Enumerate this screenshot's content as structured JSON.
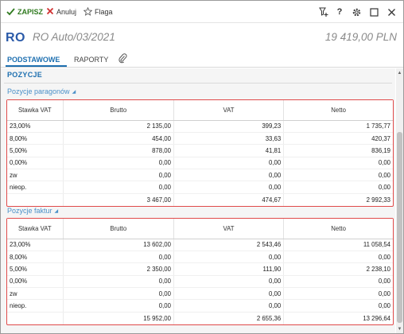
{
  "toolbar": {
    "save_label": "ZAPISZ",
    "cancel_label": "Anuluj",
    "flag_label": "Flaga",
    "right_icons": [
      "add-filter-icon",
      "help-icon",
      "gear-icon",
      "maximize-icon",
      "close-icon"
    ],
    "help_glyph": "?"
  },
  "header": {
    "badge": "RO",
    "title": "RO Auto/03/2021",
    "amount": "19 419,00 PLN"
  },
  "tabs": [
    {
      "label": "PODSTAWOWE",
      "active": true
    },
    {
      "label": "RAPORTY",
      "active": false
    }
  ],
  "section": {
    "title": "POZYCJE"
  },
  "receipts": {
    "title": "Pozycje paragonów",
    "headers": [
      "Stawka VAT",
      "Brutto",
      "VAT",
      "Netto"
    ],
    "rows": [
      {
        "rate": "23,00%",
        "gross": "2 135,00",
        "vat": "399,23",
        "net": "1 735,77"
      },
      {
        "rate": "8,00%",
        "gross": "454,00",
        "vat": "33,63",
        "net": "420,37"
      },
      {
        "rate": "5,00%",
        "gross": "878,00",
        "vat": "41,81",
        "net": "836,19"
      },
      {
        "rate": "0,00%",
        "gross": "0,00",
        "vat": "0,00",
        "net": "0,00"
      },
      {
        "rate": "zw",
        "gross": "0,00",
        "vat": "0,00",
        "net": "0,00"
      },
      {
        "rate": "nieop.",
        "gross": "0,00",
        "vat": "0,00",
        "net": "0,00"
      }
    ],
    "total": {
      "gross": "3 467,00",
      "vat": "474,67",
      "net": "2 992,33"
    }
  },
  "invoices": {
    "title": "Pozycje faktur",
    "headers": [
      "Stawka VAT",
      "Brutto",
      "VAT",
      "Netto"
    ],
    "rows": [
      {
        "rate": "23,00%",
        "gross": "13 602,00",
        "vat": "2 543,46",
        "net": "11 058,54"
      },
      {
        "rate": "8,00%",
        "gross": "0,00",
        "vat": "0,00",
        "net": "0,00"
      },
      {
        "rate": "5,00%",
        "gross": "2 350,00",
        "vat": "111,90",
        "net": "2 238,10"
      },
      {
        "rate": "0,00%",
        "gross": "0,00",
        "vat": "0,00",
        "net": "0,00"
      },
      {
        "rate": "zw",
        "gross": "0,00",
        "vat": "0,00",
        "net": "0,00"
      },
      {
        "rate": "nieop.",
        "gross": "0,00",
        "vat": "0,00",
        "net": "0,00"
      }
    ],
    "total": {
      "gross": "15 952,00",
      "vat": "2 655,36",
      "net": "13 296,64"
    }
  },
  "colors": {
    "accent": "#1d6fb0",
    "save_green": "#2f7a1f",
    "cancel_red": "#d03030",
    "highlight_border": "#e04a4a"
  }
}
